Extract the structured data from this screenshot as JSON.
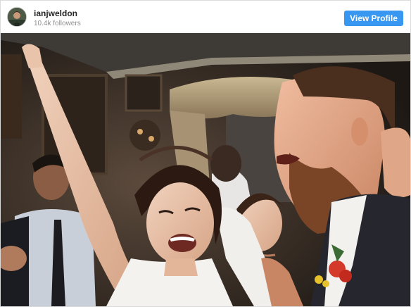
{
  "profile": {
    "username": "ianjweldon",
    "followers": "10.4k followers",
    "view_profile_label": "View Profile"
  },
  "colors": {
    "button_bg": "#3897f0",
    "button_text": "#ffffff",
    "username_text": "#262626",
    "followers_text": "#8e8e8e"
  },
  "icons": {
    "avatar": "profile-avatar"
  }
}
